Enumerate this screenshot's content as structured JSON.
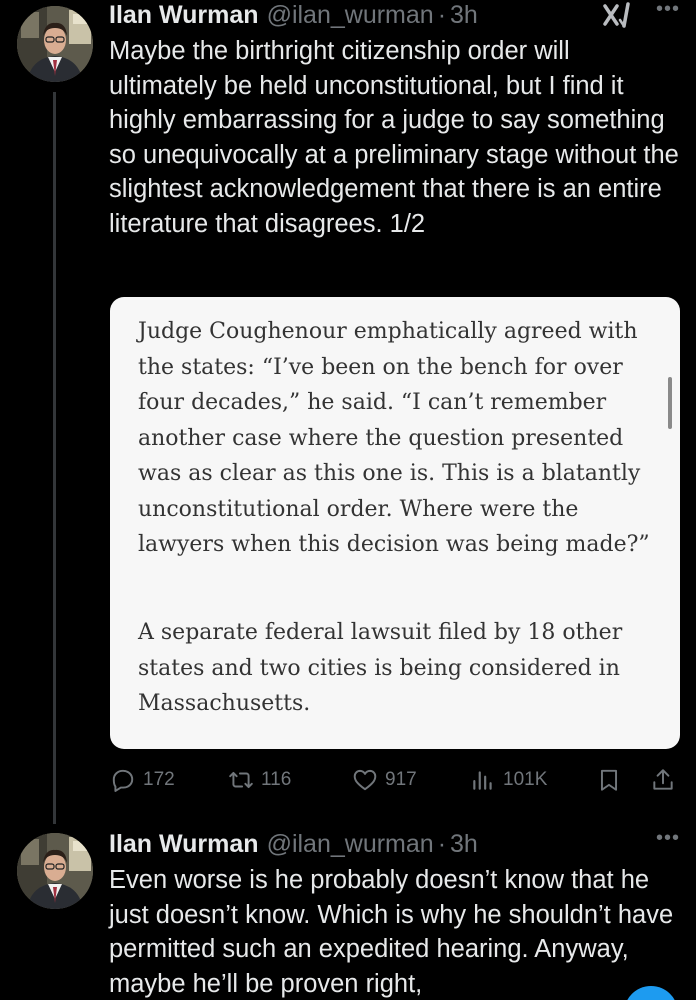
{
  "tweets": [
    {
      "display_name": "Ilan Wurman",
      "handle": "@ilan_wurman",
      "separator": "·",
      "time": "3h",
      "text": "Maybe the birthright citizenship order will ultimately be held unconstitutional, but I find it highly embarrassing for a judge to say something so unequivocally at a preliminary stage without the slightest acknowledgement that there is an entire literature that disagrees. 1/2",
      "quote_image": {
        "paragraphs": [
          "Judge Coughenour emphatically agreed with the states: “I’ve been on the bench for over four decades,” he said. “I can’t remember another case where the question presented was as clear as this one is. This is a blatantly unconstitutional order. Where were the lawyers when this decision was being made?”",
          "A separate federal lawsuit filed by 18 other states and two cities is being considered in Massachusetts."
        ]
      },
      "actions": {
        "replies": "172",
        "retweets": "116",
        "likes": "917",
        "views": "101K"
      }
    },
    {
      "display_name": "Ilan Wurman",
      "handle": "@ilan_wurman",
      "separator": "·",
      "time": "3h",
      "text": "Even worse is he probably doesn’t know that he just doesn’t know. Which is why he shouldn’t have permitted such an expedited hearing. Anyway, maybe he’ll be proven right,"
    }
  ],
  "icons": {
    "grok": "grok-icon",
    "more": "more-icon",
    "reply": "reply-icon",
    "retweet": "retweet-icon",
    "like": "heart-icon",
    "views": "views-icon",
    "bookmark": "bookmark-icon",
    "share": "share-icon"
  },
  "colors": {
    "background": "#000000",
    "text": "#e7e9ea",
    "secondary": "#71767b",
    "thread_line": "#333639",
    "quote_card_bg": "#f7f7f7",
    "accent": "#1d9bf0"
  }
}
